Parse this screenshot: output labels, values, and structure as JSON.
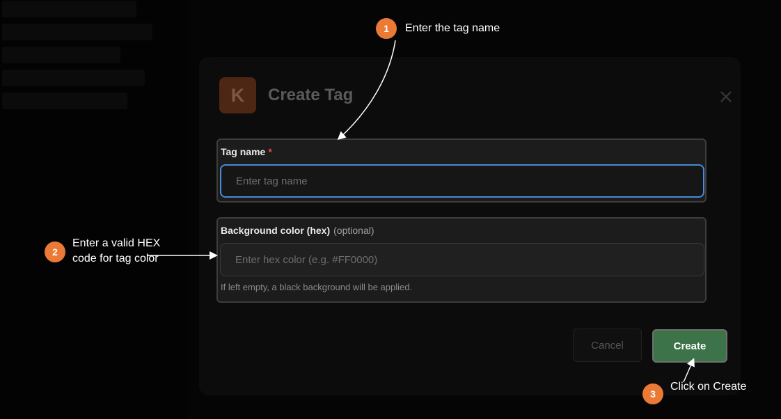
{
  "modal": {
    "logo_letter": "K",
    "title": "Create Tag",
    "close_icon": "close-icon"
  },
  "form": {
    "tag_name": {
      "label": "Tag name",
      "required_mark": "*",
      "placeholder": "Enter tag name",
      "value": ""
    },
    "background_color": {
      "label": "Background color (hex)",
      "optional_text": "(optional)",
      "placeholder": "Enter hex color (e.g. #FF0000)",
      "value": "",
      "help": "If left empty, a black background will be applied."
    }
  },
  "actions": {
    "cancel_label": "Cancel",
    "create_label": "Create"
  },
  "annotations": [
    {
      "step": "1",
      "text": "Enter the tag name"
    },
    {
      "step": "2",
      "text_line1": "Enter a valid HEX",
      "text_line2": "code for tag color"
    },
    {
      "step": "3",
      "text": "Click on Create"
    }
  ],
  "colors": {
    "accent_badge": "#ec7a37",
    "create_button": "#3c7348",
    "focus_border": "#4a8ad6",
    "required_mark": "#e74b4b",
    "logo_bg": "#4e2714"
  }
}
